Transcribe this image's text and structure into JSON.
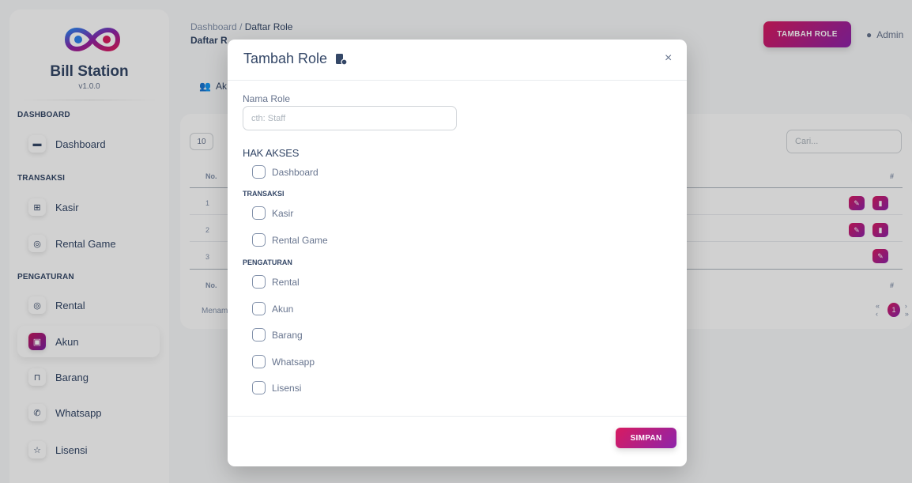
{
  "sidebar": {
    "brand": "Bill Station",
    "version": "v1.0.0",
    "sections": [
      "DASHBOARD",
      "TRANSAKSI",
      "PENGATURAN"
    ],
    "items": [
      {
        "label": "Dashboard",
        "icon": "store-icon"
      },
      {
        "label": "Kasir",
        "icon": "cash-register-icon"
      },
      {
        "label": "Rental Game",
        "icon": "game-controller-icon"
      },
      {
        "label": "Rental",
        "icon": "game-controller-icon"
      },
      {
        "label": "Akun",
        "icon": "user-card-icon",
        "active": true
      },
      {
        "label": "Barang",
        "icon": "shopping-bag-icon"
      },
      {
        "label": "Whatsapp",
        "icon": "whatsapp-icon"
      },
      {
        "label": "Lisensi",
        "icon": "badge-icon"
      }
    ]
  },
  "header": {
    "breadcrumb_root": "Dashboard",
    "breadcrumb_sep": "/",
    "breadcrumb_current": "Daftar Role",
    "page_title": "Daftar R",
    "add_button": "TAMBAH ROLE",
    "user": "Admin"
  },
  "content": {
    "tab_label": "Ak",
    "page_length": "10",
    "search_placeholder": "Cari...",
    "col_no": "No.",
    "col_action": "#",
    "rows": [
      "1",
      "2",
      "3"
    ],
    "showing_text": "Menam",
    "current_page": "1",
    "pager_prev": "«  ‹",
    "pager_next": "›  »"
  },
  "modal": {
    "title": "Tambah Role",
    "close": "×",
    "name_label": "Nama Role",
    "name_placeholder": "cth: Staff",
    "name_value": "",
    "access_title": "HAK AKSES",
    "group_transaksi": "TRANSAKSI",
    "group_pengaturan": "PENGATURAN",
    "permissions": {
      "dashboard": "Dashboard",
      "kasir": "Kasir",
      "rental_game": "Rental Game",
      "rental": "Rental",
      "akun": "Akun",
      "barang": "Barang",
      "whatsapp": "Whatsapp",
      "lisensi": "Lisensi"
    },
    "save_button": "SIMPAN"
  },
  "colors": {
    "accent_start": "#d81b60",
    "accent_end": "#8e24aa",
    "text_primary": "#344767",
    "text_muted": "#67748e"
  }
}
